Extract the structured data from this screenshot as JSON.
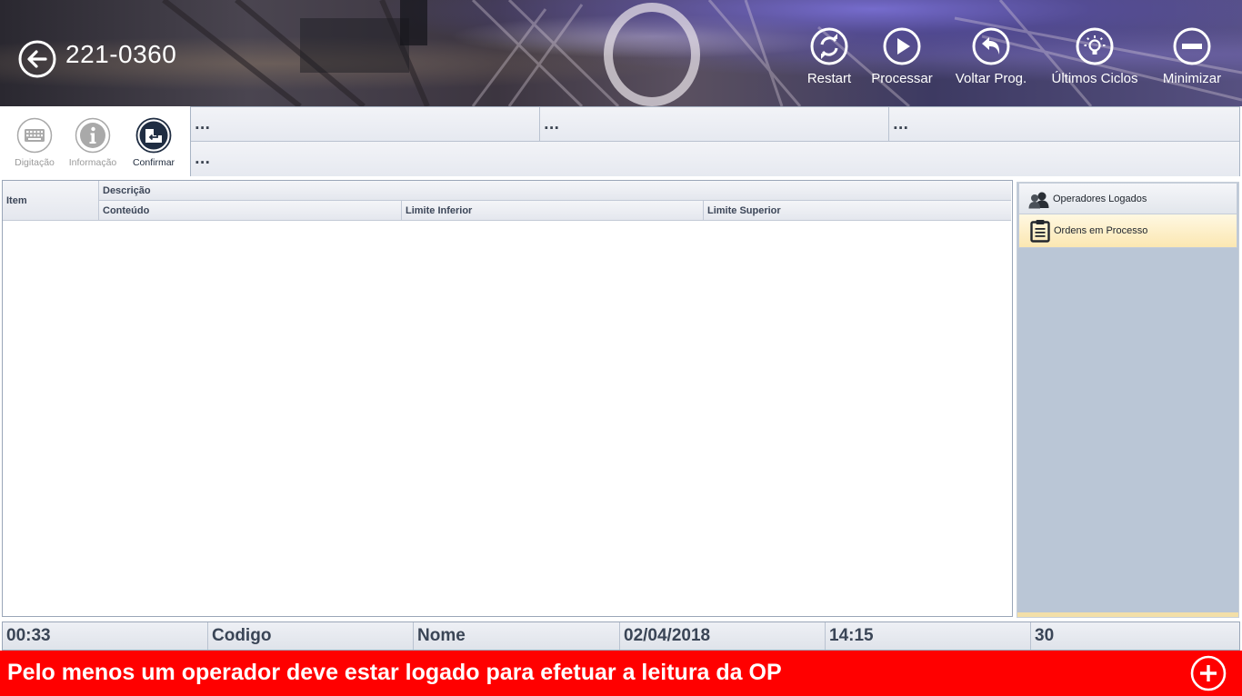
{
  "header": {
    "plant_code": "221-0360",
    "buttons": [
      {
        "label": "Restart",
        "icon": "restart-icon"
      },
      {
        "label": "Processar",
        "icon": "play-icon"
      },
      {
        "label": "Voltar Prog.",
        "icon": "undo-icon"
      },
      {
        "label": "Últimos Ciclos",
        "icon": "lightbulb-icon"
      },
      {
        "label": "Minimizar",
        "icon": "minus-icon"
      }
    ]
  },
  "toolbar": {
    "tools": [
      {
        "label": "Digitação",
        "icon": "keyboard-icon",
        "enabled": false
      },
      {
        "label": "Informação",
        "icon": "info-icon",
        "enabled": false
      },
      {
        "label": "Confirmar",
        "icon": "enter-icon",
        "enabled": true
      }
    ]
  },
  "info_fields": [
    "...",
    "...",
    "...",
    "..."
  ],
  "grid": {
    "col_item": "Item",
    "col_descricao": "Descrição",
    "col_conteudo": "Conteúdo",
    "col_limite_inferior": "Limite Inferior",
    "col_limite_superior": "Limite Superior",
    "rows": []
  },
  "side_panel": {
    "tabs": [
      {
        "label": "Operadores Logados",
        "icon": "users-icon",
        "active": false
      },
      {
        "label": "Ordens em Processo",
        "icon": "clipboard-icon",
        "active": true
      }
    ]
  },
  "status_bar": {
    "time_elapsed": "00:33",
    "codigo": "Codigo",
    "nome": "Nome",
    "date": "02/04/2018",
    "clock": "14:15",
    "count": "30"
  },
  "alert": {
    "message": "Pelo menos um operador deve estar logado para efetuar a leitura da OP",
    "color": "#ff0000"
  },
  "colors": {
    "alert_red": "#ff0000",
    "side_panel_bg": "#bac6d6",
    "active_tab": "#fdf0c8"
  }
}
